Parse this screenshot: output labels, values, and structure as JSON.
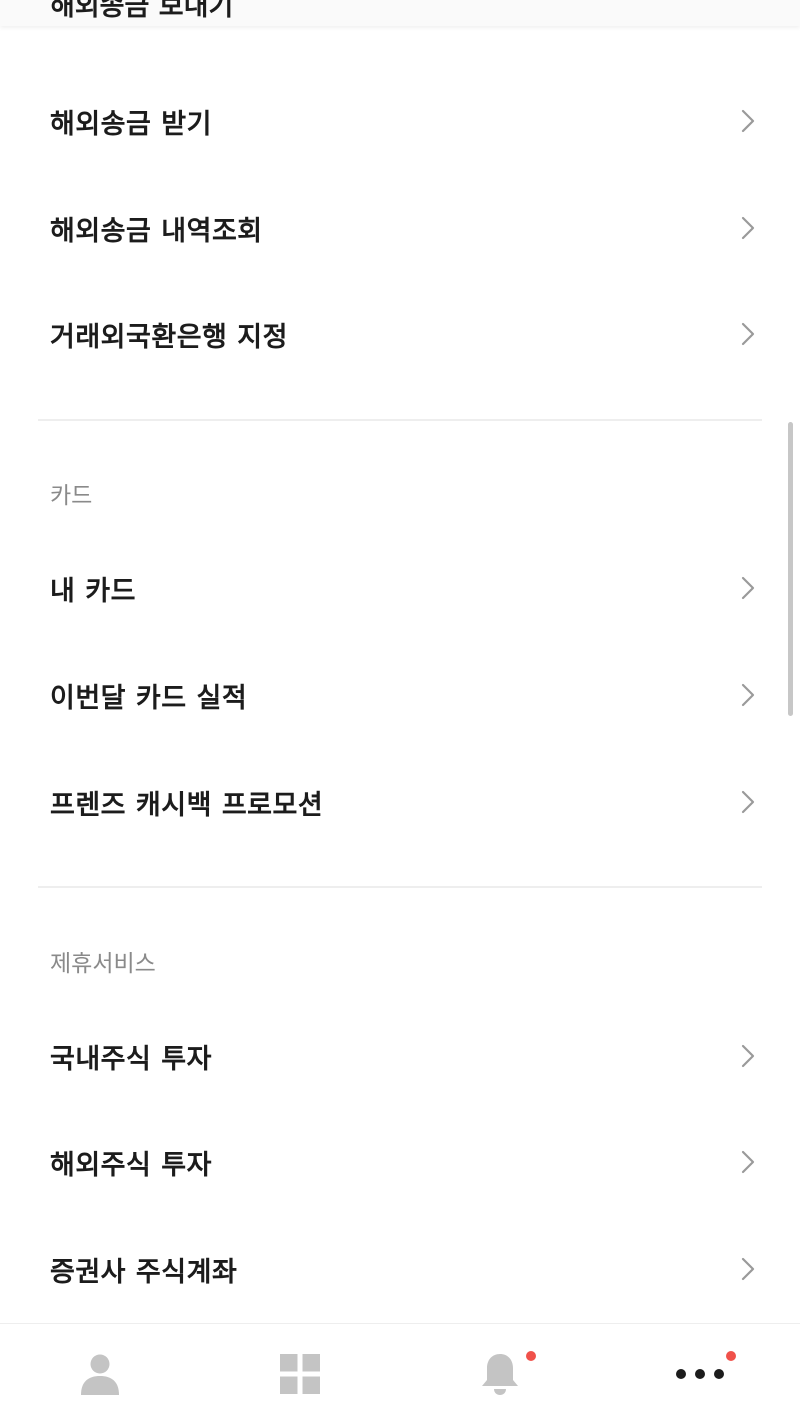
{
  "header": {
    "cut_off_title": "해외송금 보내기"
  },
  "sections": {
    "remittance": {
      "items": [
        {
          "label": "해외송금 받기"
        },
        {
          "label": "해외송금 내역조회"
        },
        {
          "label": "거래외국환은행 지정"
        }
      ]
    },
    "card": {
      "title": "카드",
      "items": [
        {
          "label": "내 카드"
        },
        {
          "label": "이번달 카드 실적"
        },
        {
          "label": "프렌즈 캐시백 프로모션"
        }
      ]
    },
    "partner": {
      "title": "제휴서비스",
      "items": [
        {
          "label": "국내주식 투자"
        },
        {
          "label": "해외주식 투자"
        },
        {
          "label": "증권사 주식계좌"
        }
      ]
    }
  },
  "tabbar": {
    "tabs": [
      {
        "icon": "person-icon",
        "has_badge": false
      },
      {
        "icon": "grid-icon",
        "has_badge": false
      },
      {
        "icon": "bell-icon",
        "has_badge": true
      },
      {
        "icon": "more-dots-icon",
        "has_badge": true
      }
    ]
  },
  "colors": {
    "badge": "#f0514a",
    "icon_inactive": "#c4c4c4",
    "icon_active": "#1c1c1c",
    "section_header": "#8a8a8a",
    "chevron": "#9a9a9a"
  }
}
